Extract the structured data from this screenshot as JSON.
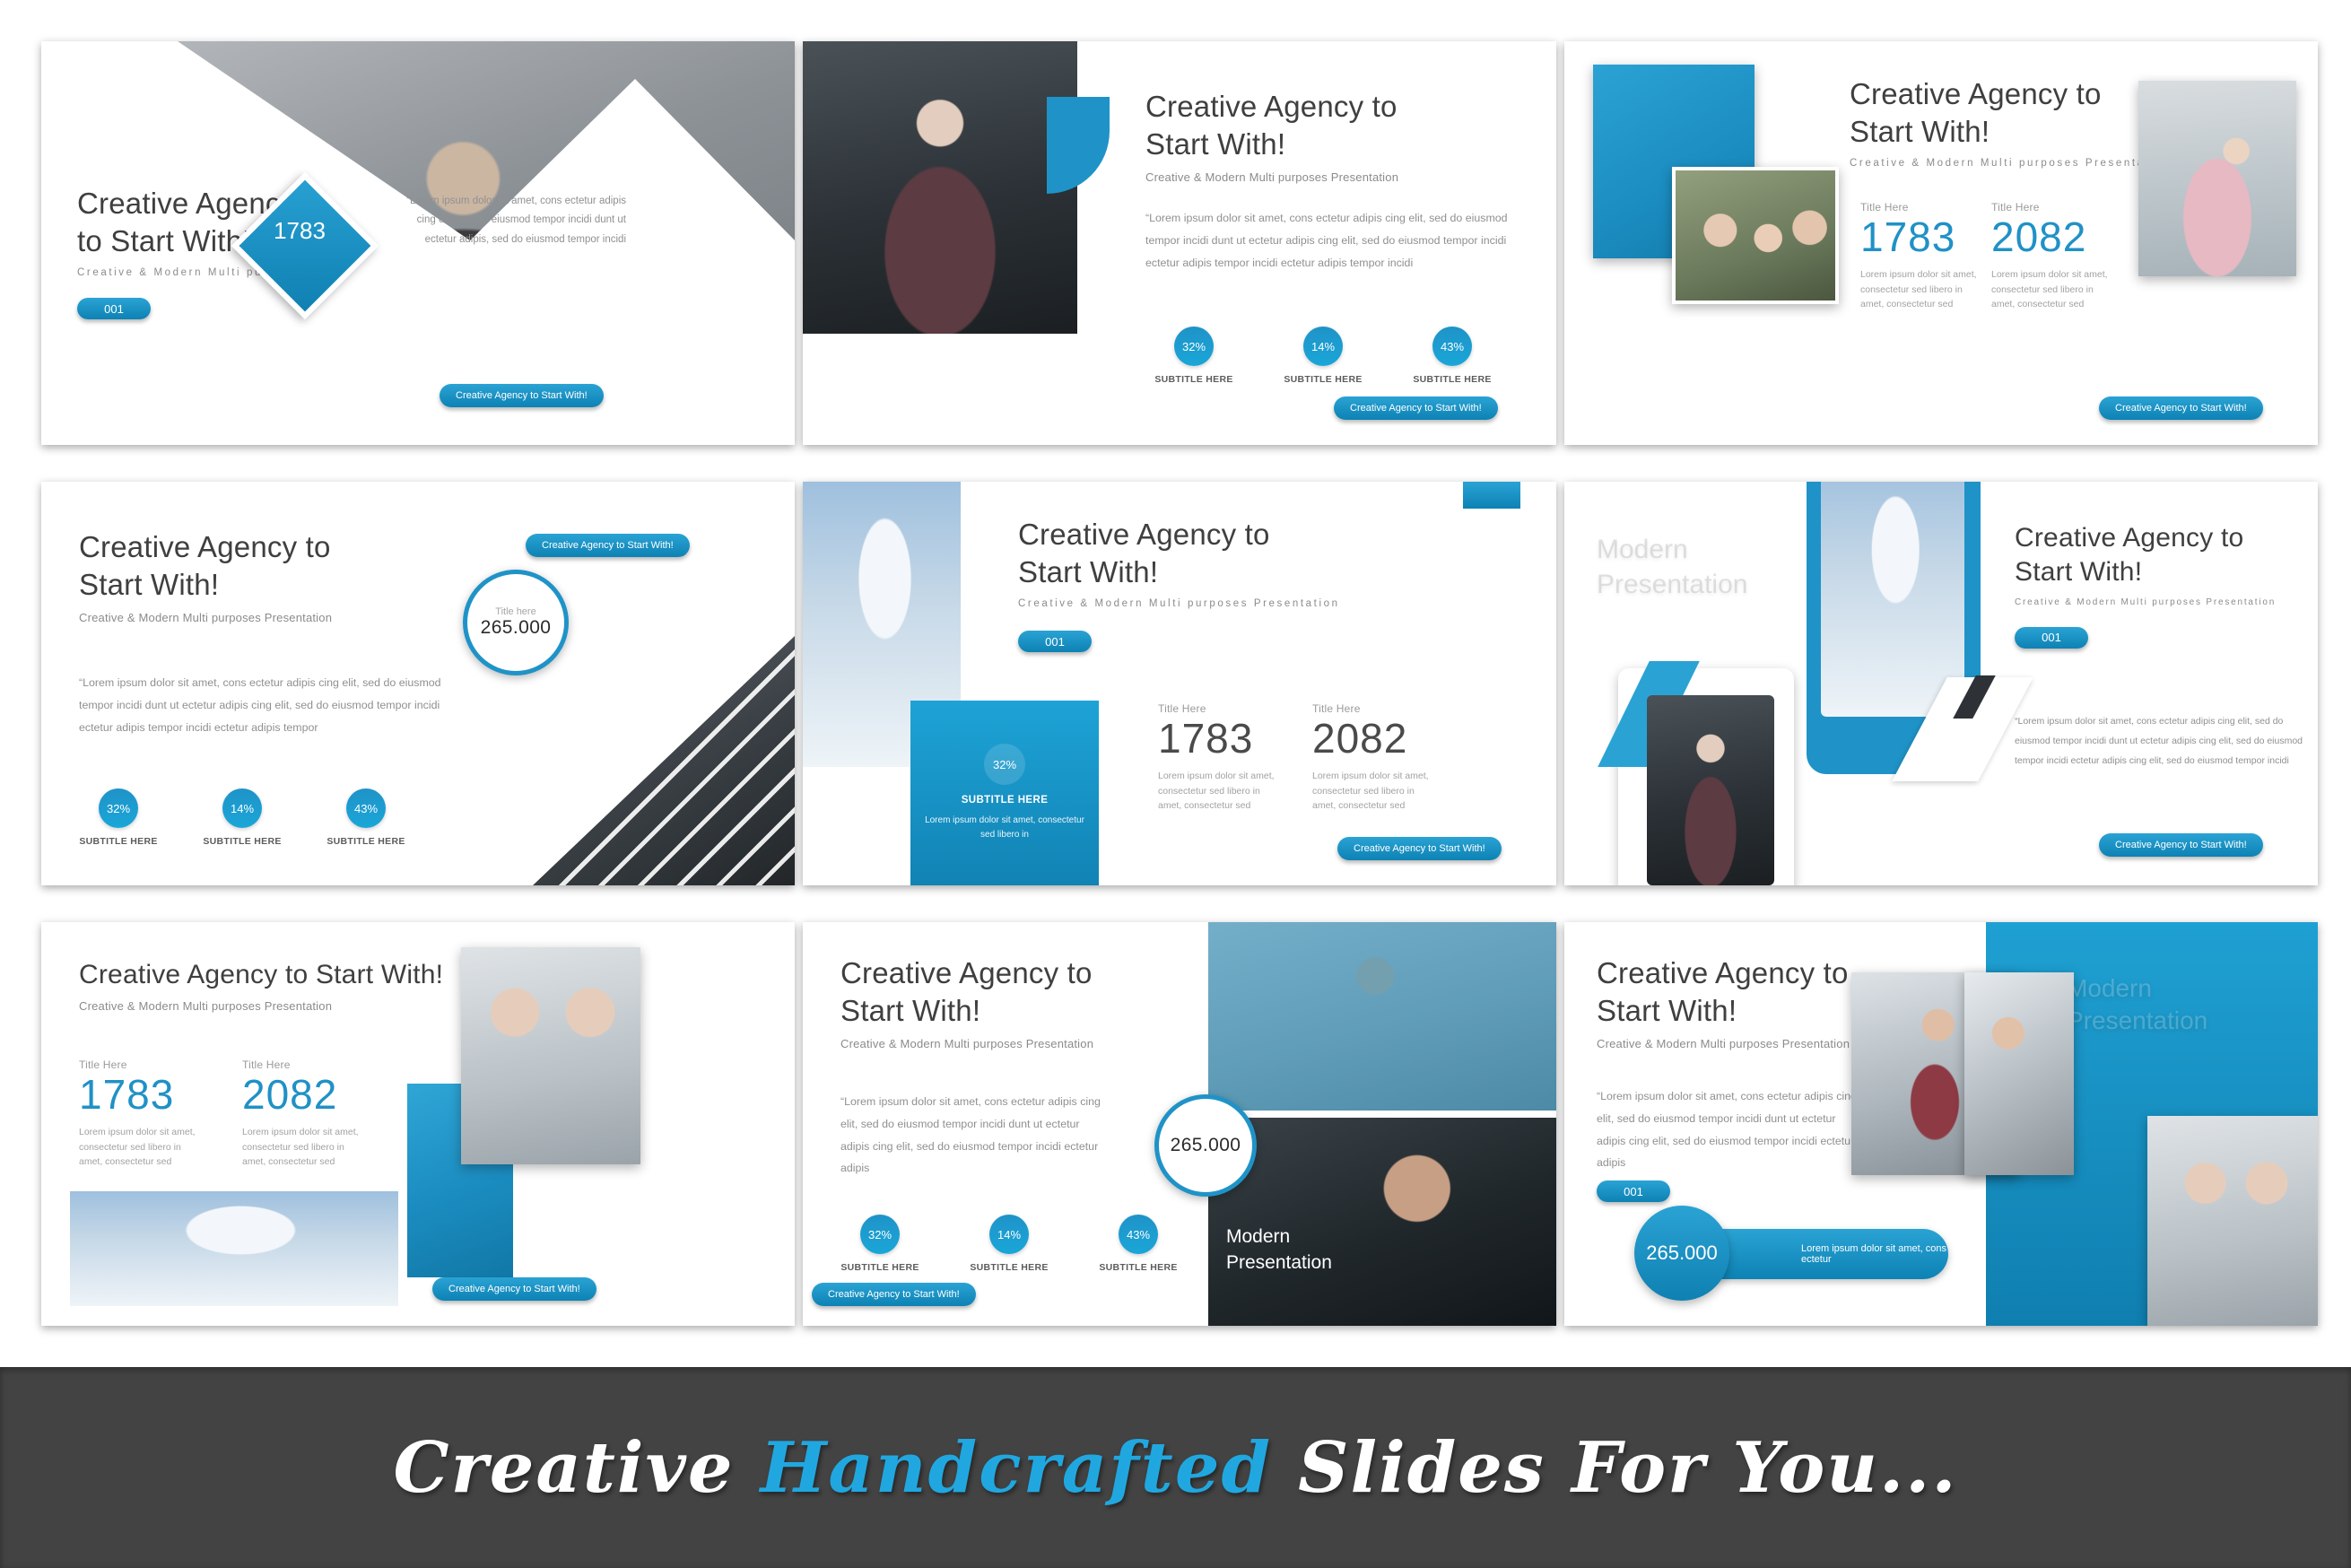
{
  "common": {
    "title_two_line": "Creative Agency to\nStart With!",
    "title_line1": "Creative Agency",
    "title_line2": "to Start With!",
    "title_one_line": "Creative Agency to Start With!",
    "subtitle_short": "Creative & Modern Multi purposes",
    "subtitle_full": "Creative & Modern Multi purposes Presentation",
    "cta_label": "Creative Agency to Start With!",
    "number_badge": "001",
    "title_here": "Title Here",
    "title_here_lower": "Title here",
    "stat_1783": "1783",
    "stat_2082": "2082",
    "stat_265": "265.000",
    "stat_desc": "Lorem ipsum dolor sit amet, consectetur sed libero in amet, consectetur sed",
    "subtitle_here": "SUBTITLE HERE",
    "modern_presentation": "Modern\nPresentation",
    "modern_line1": "Modern",
    "modern_line2": "Presentation",
    "percents": [
      "32%",
      "14%",
      "43%"
    ],
    "quote_1": "“Lorem ipsum dolor sit amet, cons ectetur adipis cing elit, sed do eiusmod tempor incidi dunt ut ectetur adipis, sed do eiusmod tempor incidi",
    "quote_2": "“Lorem ipsum dolor sit amet, cons ectetur adipis cing elit, sed do eiusmod tempor incidi dunt ut ectetur adipis cing elit, sed do eiusmod tempor incidi ectetur adipis tempor incidi ectetur adipis tempor incidi",
    "quote_3": "“Lorem ipsum dolor sit amet, cons ectetur adipis cing elit, sed do eiusmod tempor incidi dunt ut ectetur adipis cing elit, sed do eiusmod tempor incidi ectetur adipis tempor incidi ectetur adipis tempor",
    "quote_4": "“Lorem ipsum dolor sit amet, cons ectetur adipis cing elit, sed do eiusmod tempor incidi dunt ut ectetur adipis cing elit, sed do eiusmod tempor incidi ectetur adipis cing elit, sed do eiusmod tempor incidi",
    "quote_5": "“Lorem ipsum dolor sit amet, cons ectetur adipis cing elit, sed do eiusmod tempor incidi dunt ut ectetur adipis cing elit, sed do eiusmod tempor incidi ectetur adipis",
    "card_desc": "Lorem ipsum dolor sit amet, consectetur sed libero in",
    "pill_desc": "Lorem ipsum dolor sit amet, cons ectetur"
  },
  "banner": {
    "part1": "Creative ",
    "highlight": "Handcrafted",
    "part2": " Slides For You..."
  },
  "colors": {
    "accent": "#1f93c8",
    "accent_light": "#2aa3d4",
    "accent_dark": "#0d82b4",
    "banner_bg": "#434343",
    "banner_highlight": "#21a7e0",
    "title_gray": "#3f3f3f",
    "body_gray": "#909090"
  }
}
